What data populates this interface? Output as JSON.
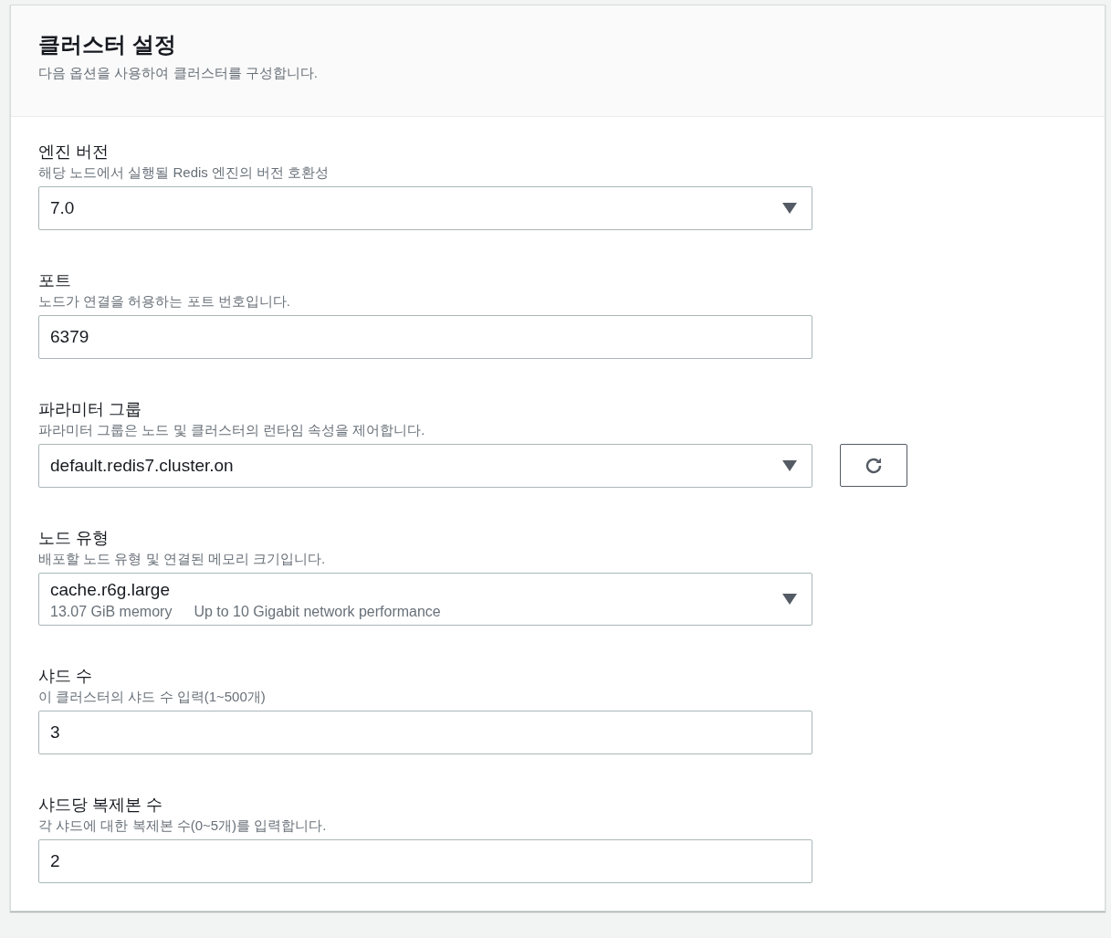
{
  "panel": {
    "title": "클러스터 설정",
    "description": "다음 옵션을 사용하여 클러스터를 구성합니다."
  },
  "fields": [
    {
      "kind": "select",
      "label": "엔진 버전",
      "description": "해당 노드에서 실행될 Redis 엔진의 버전 호환성",
      "value": "7.0"
    },
    {
      "kind": "input",
      "label": "포트",
      "description": "노드가 연결을 허용하는 포트 번호입니다.",
      "value": "6379"
    },
    {
      "kind": "select",
      "label": "파라미터 그룹",
      "description": "파라미터 그룹은 노드 및 클러스터의 런타임 속성을 제어합니다.",
      "value": "default.redis7.cluster.on",
      "refresh_button": true
    },
    {
      "kind": "select",
      "label": "노드 유형",
      "description": "배포할 노드 유형 및 연결된 메모리 크기입니다.",
      "value": "cache.r6g.large",
      "details": [
        "13.07 GiB memory",
        "Up to 10 Gigabit network performance"
      ]
    },
    {
      "kind": "input",
      "label": "샤드 수",
      "description": "이 클러스터의 샤드 수 입력(1~500개)",
      "value": "3"
    },
    {
      "kind": "input",
      "label": "샤드당 복제본 수",
      "description": "각 샤드에 대한 복제본 수(0~5개)를 입력합니다.",
      "value": "2"
    }
  ]
}
